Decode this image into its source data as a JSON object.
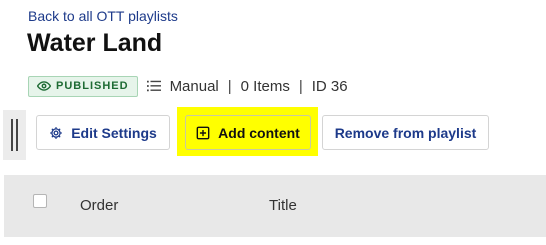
{
  "nav": {
    "back_label": "Back to all OTT playlists"
  },
  "header": {
    "title": "Water Land"
  },
  "meta": {
    "status_badge": "PUBLISHED",
    "status_icon": "eye-icon",
    "order_icon": "list-icon",
    "order_mode": "Manual",
    "separator": "|",
    "item_count": "0 Items",
    "id_label": "ID 36"
  },
  "toolbar": {
    "edit_label": "Edit Settings",
    "edit_icon": "gear-icon",
    "add_label": "Add content",
    "add_icon": "plus-square-icon",
    "remove_label": "Remove from playlist",
    "highlight_color": "#ffff00"
  },
  "table": {
    "columns": [
      "Order",
      "Title"
    ]
  },
  "colors": {
    "link": "#1d3a8a",
    "published_bg": "#e6f4ea",
    "published_text": "#1e6b34",
    "table_header_bg": "#e8e8e8"
  }
}
